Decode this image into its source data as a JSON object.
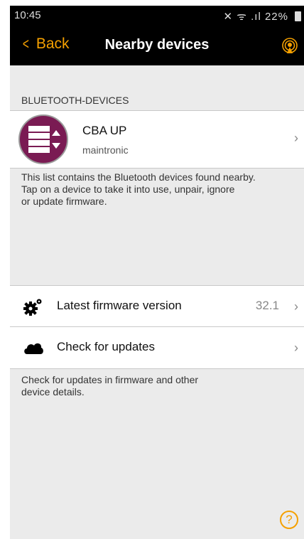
{
  "status": {
    "time": "10:45",
    "icons": "🔇 📶 .││",
    "battery": "22%"
  },
  "nav": {
    "back_label": "Back",
    "title": "Nearby devices"
  },
  "section": {
    "header": "BLUETOOTH-DEVICES"
  },
  "device": {
    "name": "CBA UP",
    "subtitle": "maintronic"
  },
  "help1": "This list contains the Bluetooth devices found nearby.\nTap on a device to take it into use, unpair, ignore\nor update firmware.",
  "firmware": {
    "label": "Latest firmware version",
    "value": "32.1"
  },
  "updates": {
    "label": "Check for updates"
  },
  "help2": "Check for updates in firmware and other\ndevice details.",
  "help_button": "?",
  "colors": {
    "accent": "#f5a000",
    "device_avatar": "#7a1b53",
    "background": "#ebebeb"
  }
}
